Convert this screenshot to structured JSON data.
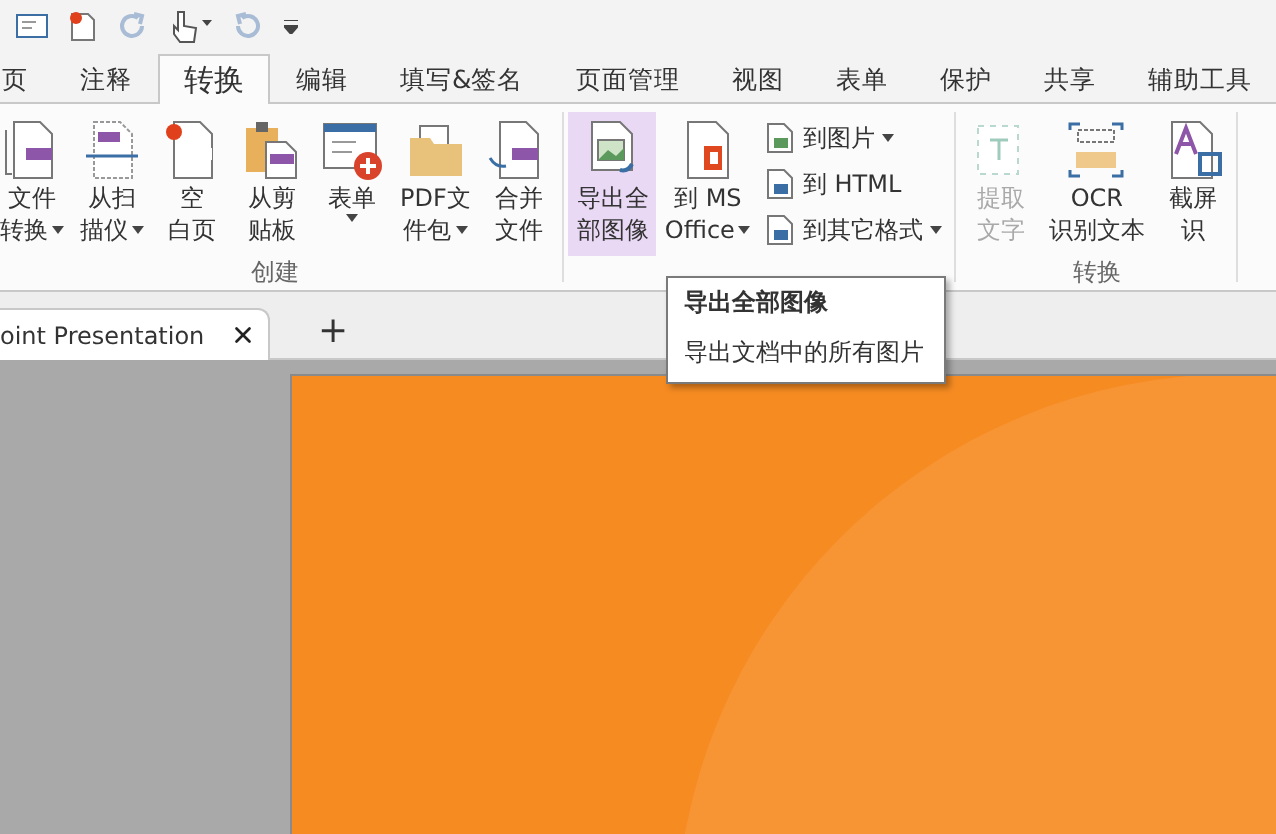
{
  "menu_tabs": [
    {
      "label": "页",
      "selected": false
    },
    {
      "label": "注释",
      "selected": false
    },
    {
      "label": "转换",
      "selected": true
    },
    {
      "label": "编辑",
      "selected": false
    },
    {
      "label": "填写&签名",
      "selected": false
    },
    {
      "label": "页面管理",
      "selected": false
    },
    {
      "label": "视图",
      "selected": false
    },
    {
      "label": "表单",
      "selected": false
    },
    {
      "label": "保护",
      "selected": false
    },
    {
      "label": "共享",
      "selected": false
    },
    {
      "label": "辅助工具",
      "selected": false
    }
  ],
  "ribbon": {
    "groups": [
      {
        "label": "创建",
        "buttons": [
          {
            "kind": "large",
            "lines": [
              "文件",
              "转换"
            ],
            "dropdown": true,
            "disabled": false,
            "hovered": false
          },
          {
            "kind": "large",
            "lines": [
              "从扫",
              "描仪"
            ],
            "dropdown": true,
            "disabled": false,
            "hovered": false
          },
          {
            "kind": "large",
            "lines": [
              "空",
              "白页"
            ],
            "dropdown": false,
            "disabled": false,
            "hovered": false
          },
          {
            "kind": "large",
            "lines": [
              "从剪",
              "贴板"
            ],
            "dropdown": false,
            "disabled": false,
            "hovered": false
          },
          {
            "kind": "large",
            "lines": [
              "表单"
            ],
            "dropdown": true,
            "disabled": false,
            "hovered": false
          },
          {
            "kind": "large",
            "lines": [
              "PDF文",
              "件包"
            ],
            "dropdown": true,
            "disabled": false,
            "hovered": false
          },
          {
            "kind": "large",
            "lines": [
              "合并",
              "文件"
            ],
            "dropdown": false,
            "disabled": false,
            "hovered": false
          }
        ]
      },
      {
        "buttons": [
          {
            "kind": "large",
            "lines": [
              "导出全",
              "部图像"
            ],
            "dropdown": false,
            "disabled": false,
            "hovered": true
          },
          {
            "kind": "large",
            "lines": [
              "到 MS",
              "Office"
            ],
            "dropdown": true,
            "disabled": false,
            "hovered": false
          },
          {
            "kind": "small",
            "lines": [
              "到图片"
            ],
            "dropdown": true
          },
          {
            "kind": "small",
            "lines": [
              "到 HTML"
            ],
            "dropdown": false
          },
          {
            "kind": "small",
            "lines": [
              "到其它格式"
            ],
            "dropdown": true
          }
        ]
      },
      {
        "label": "转换",
        "buttons": [
          {
            "kind": "large",
            "lines": [
              "提取",
              "文字"
            ],
            "dropdown": false,
            "disabled": true,
            "hovered": false
          },
          {
            "kind": "large",
            "lines": [
              "OCR",
              "识别文本"
            ],
            "dropdown": false,
            "disabled": false,
            "hovered": false
          },
          {
            "kind": "large",
            "lines": [
              "截屏",
              "识"
            ],
            "dropdown": false,
            "disabled": false,
            "hovered": false
          }
        ]
      }
    ]
  },
  "tooltip": {
    "title": "导出全部图像",
    "text": "导出文档中的所有图片"
  },
  "doc_tabs": [
    {
      "label": "oint Presentation",
      "selected": true
    }
  ],
  "new_tab": "+"
}
